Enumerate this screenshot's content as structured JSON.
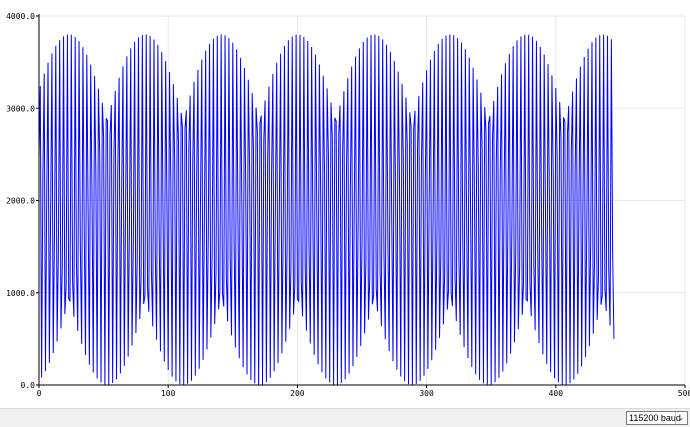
{
  "baud": {
    "selected": "115200 baud",
    "arrow_icon": "chevron-down-icon"
  },
  "chart_data": {
    "type": "line",
    "title": "",
    "xlabel": "",
    "ylabel": "",
    "xlim": [
      0,
      500
    ],
    "ylim": [
      0,
      4000
    ],
    "x_ticks": [
      0,
      100,
      200,
      300,
      400,
      500
    ],
    "x_tick_labels": [
      "0",
      "100",
      "200",
      "300",
      "400",
      "500"
    ],
    "y_ticks": [
      0,
      1000,
      2000,
      3000,
      4000
    ],
    "y_tick_labels": [
      "0.0",
      "1000.0",
      "2000.0",
      "3000.0",
      "4000.0"
    ],
    "grid": true,
    "series_color": "#0000ff",
    "samples": 446,
    "series": [
      {
        "description": "aliased sine samples swinging between about 0 and 3800",
        "period_samples": 3.0517,
        "offset": 1900,
        "amplitude": 1900,
        "phase": 0.3,
        "x_start": 0,
        "x_end": 445
      }
    ]
  }
}
